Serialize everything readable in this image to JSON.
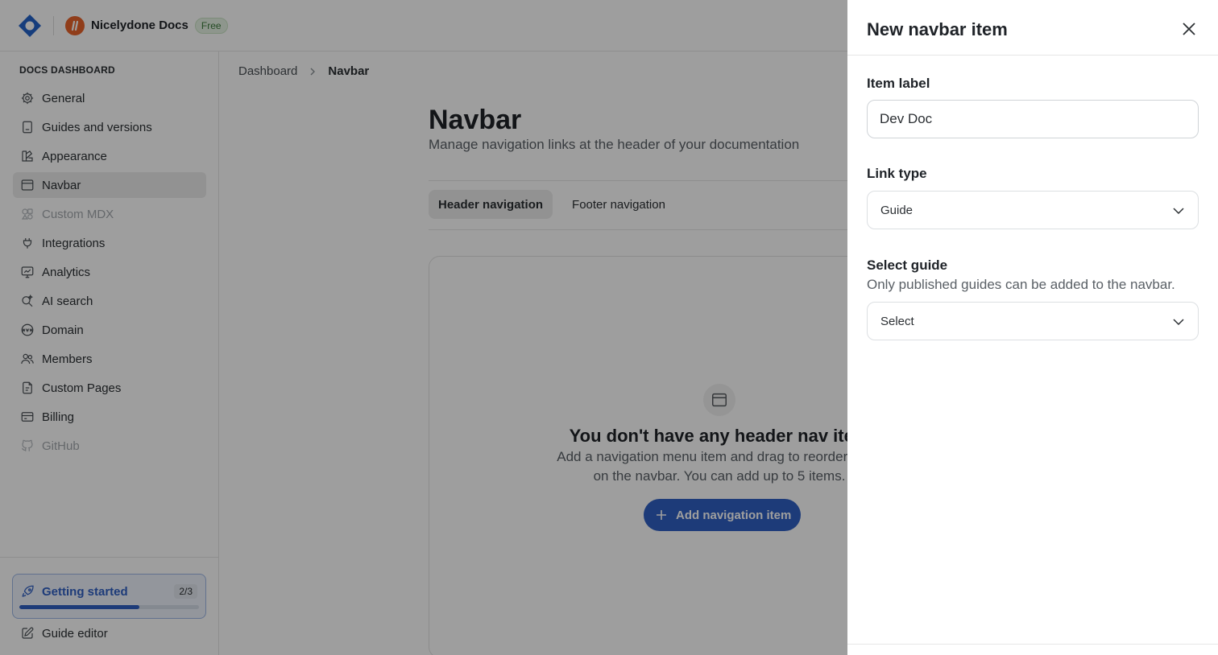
{
  "topbar": {
    "project_name": "Nicelydone Docs",
    "plan_badge": "Free"
  },
  "sidebar": {
    "heading": "DOCS DASHBOARD",
    "items": [
      {
        "label": "General",
        "icon": "gear-icon"
      },
      {
        "label": "Guides and versions",
        "icon": "book-icon"
      },
      {
        "label": "Appearance",
        "icon": "palette-icon"
      },
      {
        "label": "Navbar",
        "icon": "browser-window-icon"
      },
      {
        "label": "Custom MDX",
        "icon": "shapes-icon"
      },
      {
        "label": "Integrations",
        "icon": "plug-icon"
      },
      {
        "label": "Analytics",
        "icon": "chart-icon"
      },
      {
        "label": "AI search",
        "icon": "ai-search-icon"
      },
      {
        "label": "Domain",
        "icon": "www-globe-icon"
      },
      {
        "label": "Members",
        "icon": "users-icon"
      },
      {
        "label": "Custom Pages",
        "icon": "pages-icon"
      },
      {
        "label": "Billing",
        "icon": "credit-card-icon"
      },
      {
        "label": "GitHub",
        "icon": "github-icon"
      }
    ],
    "getting_started": {
      "label": "Getting started",
      "count": "2/3",
      "progress": 0.67
    },
    "guide_editor_label": "Guide editor"
  },
  "main": {
    "breadcrumb": {
      "root": "Dashboard",
      "current": "Navbar"
    },
    "title": "Navbar",
    "subtitle": "Manage navigation links at the header of your documentation",
    "tabs": [
      {
        "label": "Header navigation",
        "active": true
      },
      {
        "label": "Footer navigation",
        "active": false
      }
    ],
    "empty_state": {
      "title": "You don't have any header nav item",
      "line1": "Add a navigation menu item and drag to reorder them",
      "line2": "on the navbar. You can add up to 5 items.",
      "button_label": "Add navigation item"
    }
  },
  "drawer": {
    "title": "New navbar item",
    "item_label": {
      "label": "Item label",
      "value": "Dev Doc"
    },
    "link_type": {
      "label": "Link type",
      "value": "Guide"
    },
    "select_guide": {
      "label": "Select guide",
      "help": "Only published guides can be added to the navbar.",
      "value": "Select"
    }
  },
  "colors": {
    "accent": "#2f5fc4",
    "project_avatar": "#e8632b",
    "logo": "#2563c9",
    "overlay": "rgba(0,0,0,0.38)"
  }
}
